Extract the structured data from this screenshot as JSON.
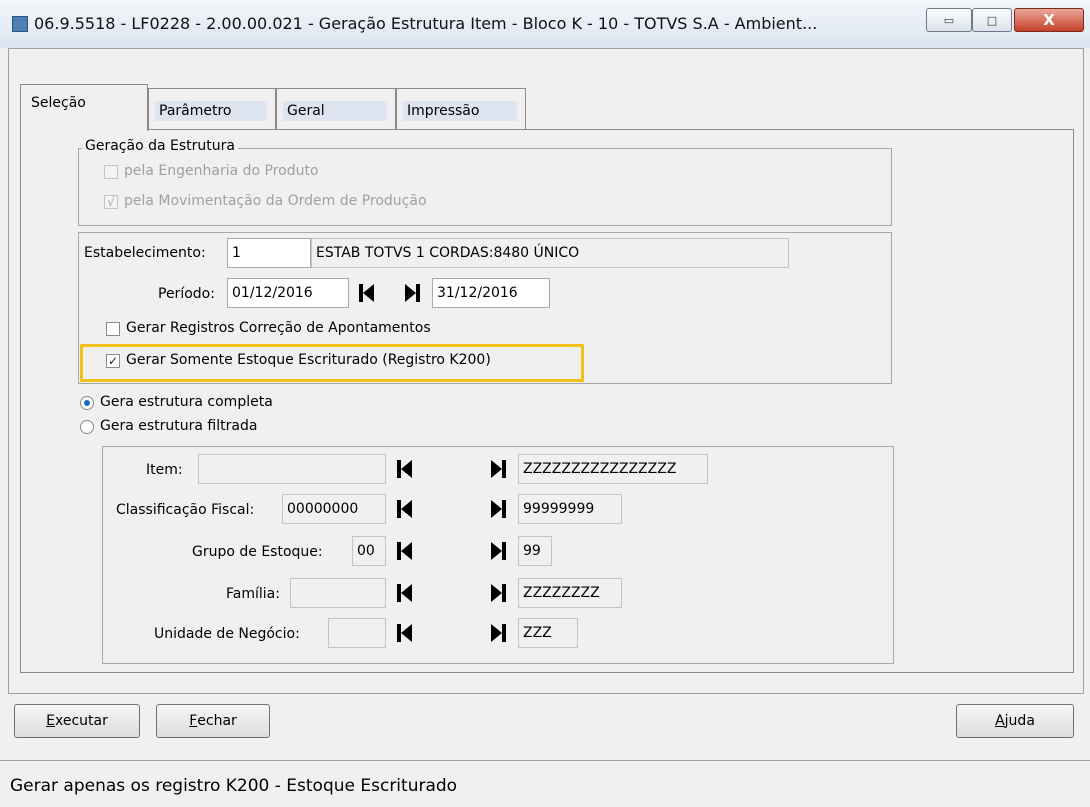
{
  "window": {
    "title": "06.9.5518 - LF0228 - 2.00.00.021 - Geração Estrutura Item - Bloco K - 10 - TOTVS S.A - Ambient...",
    "minimize_glyph": "▭",
    "maximize_glyph": "□",
    "close_glyph": "X"
  },
  "tabs": [
    {
      "label": "Seleção"
    },
    {
      "label": "Parâmetro"
    },
    {
      "label": "Geral"
    },
    {
      "label": "Impressão"
    }
  ],
  "geracao": {
    "title": "Geração da Estrutura",
    "engenharia_label": "pela Engenharia do Produto",
    "movimentacao_label": "pela Movimentação da Ordem de Produção",
    "movimentacao_check": "√"
  },
  "estab": {
    "label": "Estabelecimento:",
    "value": "1",
    "description": "ESTAB TOTVS 1 CORDAS:8480 ÚNICO"
  },
  "periodo": {
    "label": "Período:",
    "start": "01/12/2016",
    "end": "31/12/2016"
  },
  "options": {
    "correcao_label": "Gerar Registros Correção de Apontamentos",
    "somente_label": "Gerar Somente Estoque Escriturado (Registro K200)",
    "somente_check": "✓"
  },
  "radios": {
    "completa_label": "Gera estrutura completa",
    "filtrada_label": "Gera estrutura filtrada"
  },
  "filters": {
    "item": {
      "label": "Item:",
      "from": "",
      "to": "ZZZZZZZZZZZZZZZZ"
    },
    "classificacao": {
      "label": "Classificação Fiscal:",
      "from": "00000000",
      "to": "99999999"
    },
    "grupo": {
      "label": "Grupo de Estoque:",
      "from": "00",
      "to": "99"
    },
    "familia": {
      "label": "Família:",
      "from": "",
      "to": "ZZZZZZZZ"
    },
    "unidade": {
      "label": "Unidade de Negócio:",
      "from": "",
      "to": "ZZZ"
    }
  },
  "buttons": {
    "executar_key": "E",
    "executar_rest": "xecutar",
    "fechar_key": "F",
    "fechar_rest": "echar",
    "ajuda_key": "A",
    "ajuda_rest": "juda"
  },
  "status": {
    "text": "Gerar apenas os registro K200 - Estoque Escriturado"
  },
  "colors": {
    "highlight": "#f2c21a",
    "radio_selected": "#2166c9",
    "tab_fill": "#dfe5f0"
  },
  "icons": [
    "app-icon",
    "first-record-icon",
    "last-record-icon",
    "checkbox-check-icon",
    "minimize-icon",
    "maximize-icon",
    "close-icon"
  ]
}
